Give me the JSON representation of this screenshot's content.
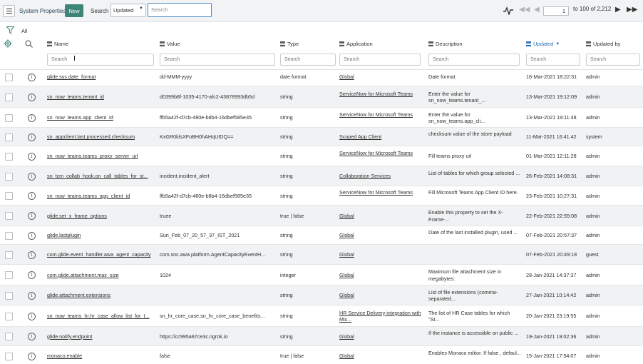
{
  "toolbar": {
    "title": "System Properties",
    "new_label": "New",
    "search_label": "Search",
    "search_field": "Updated",
    "search_placeholder": "Search",
    "page_current": "1",
    "page_range": "to 100 of 2,212"
  },
  "filter": {
    "label": "All"
  },
  "columns": [
    {
      "key": "name",
      "label": "Name"
    },
    {
      "key": "value",
      "label": "Value"
    },
    {
      "key": "type",
      "label": "Type"
    },
    {
      "key": "application",
      "label": "Application"
    },
    {
      "key": "description",
      "label": "Description"
    },
    {
      "key": "updated",
      "label": "Updated",
      "sorted": "desc"
    },
    {
      "key": "updated_by",
      "label": "Updated by"
    }
  ],
  "column_search_placeholder": "Search",
  "rows": [
    {
      "name": "glide.sys.date_format",
      "value": "dd-MMM-yyyy",
      "type": "date format",
      "application": "Global",
      "description": "Date format",
      "updated": "16-Mar-2021 18:22:31",
      "updated_by": "admin"
    },
    {
      "name": "sn_now_teams.tenant_id",
      "value": "d0399b8f-1035-4170-afc2-43878993db5d",
      "type": "string",
      "application": "ServiceNow for Microsoft Teams",
      "description": "Enter the value for sn_now_teams.tenant_...",
      "updated": "13-Mar-2021 19:12:09",
      "updated_by": "admin"
    },
    {
      "name": "sn_now_teams.app_client_id",
      "value": "ffb5a42f-d7cb-480e-b8b4-16dbef585e35",
      "type": "string",
      "application": "ServiceNow for Microsoft Teams",
      "description": "Enter the value for sn_now_teams.app_cli...",
      "updated": "13-Mar-2021 19:11:48",
      "updated_by": "admin"
    },
    {
      "name": "sn_appclient.last.processed.checksum",
      "value": "KxGR0klsXFoBH0hAHqUIDQ==",
      "type": "string",
      "application": "Scoped App Client",
      "description": "checksum value of the store payload",
      "updated": "11-Mar-2021 16:41:42",
      "updated_by": "system"
    },
    {
      "name": "sn_now_teams.teams_proxy_server_url",
      "value": "",
      "type": "string",
      "application": "ServiceNow for Microsoft Teams",
      "description": "Fill teams proxy url",
      "updated": "01-Mar-2021 12:11:28",
      "updated_by": "admin"
    },
    {
      "name": "sn_tcm_collab_hook.on_call_tables_for_st...",
      "value": "incident,incident_alert",
      "type": "string",
      "application": "Collaboration Services",
      "description": "List of tables for which group selected ...",
      "updated": "26-Feb-2021 14:08:31",
      "updated_by": "admin"
    },
    {
      "name": "sn_now_teams.teams_app_client_id",
      "value": "ffb5a42f-d7cb-480e-b8b4-16dbef585e35",
      "type": "string",
      "application": "ServiceNow for Microsoft Teams",
      "description": "Fill Microsoft Teams App Client ID here.",
      "updated": "23-Feb-2021 10:27:31",
      "updated_by": "admin"
    },
    {
      "name": "glide.set_x_frame_options",
      "value": "truee",
      "type": "true | false",
      "application": "Global",
      "description": "Enable this property to set the X-Frame-...",
      "updated": "22-Feb-2021 22:55:08",
      "updated_by": "admin"
    },
    {
      "name": "glide.lastplugin",
      "value": "Sun_Feb_07_20_57_37_IST_2021",
      "type": "string",
      "application": "Global",
      "description": "Date of the last installed plugin, used ...",
      "updated": "07-Feb-2021 20:57:37",
      "updated_by": "admin"
    },
    {
      "name": "com.glide.event_handler.awa_agent_capacity",
      "value": "com.snc.awa.platform.AgentCapacityEventH...",
      "type": "string",
      "application": "Global",
      "description": "",
      "updated": "07-Feb-2021 20:49:18",
      "updated_by": "guest"
    },
    {
      "name": "com.glide.attachment.max_size",
      "value": "1024",
      "type": "integer",
      "application": "Global",
      "description": "Maximum file attachment size in megabytes:",
      "updated": "28-Jan-2021 14:37:37",
      "updated_by": "admin"
    },
    {
      "name": "glide.attachment.extensions",
      "value": "",
      "type": "string",
      "application": "Global",
      "description": "List of file extensions (comma-separated...",
      "updated": "27-Jan-2021 10:14:42",
      "updated_by": "admin"
    },
    {
      "name": "sn_now_teams_hr.hr_case_allow_list_for_t...",
      "value": "sn_hr_core_case,sn_hr_core_case_benefits...",
      "type": "string",
      "application": "HR Service Delivery integration with Mic...",
      "description": "The list of HR Case tables for which \"St...",
      "updated": "20-Jan-2021 23:19:55",
      "updated_by": "admin"
    },
    {
      "name": "glide.notify.endpoint",
      "value": "https://cc995a97ce3c.ngrok.io",
      "type": "string",
      "application": "Global",
      "description": "If the instance is accessible on public ...",
      "updated": "19-Jan-2021 19:02:36",
      "updated_by": "admin"
    },
    {
      "name": "monaco.enable",
      "value": "false",
      "type": "true | false",
      "application": "Global",
      "description": "Enables Monaco editor. If false , defaul...",
      "updated": "15-Jan-2021 17:54:07",
      "updated_by": "admin"
    }
  ],
  "colors": {
    "new_button": "#3d8577",
    "sorted_header": "#2a6fb3",
    "search_focus": "#4a88c5"
  },
  "icons": [
    "menu-icon",
    "caret-down-icon",
    "activity-icon",
    "first-page-icon",
    "prev-page-icon",
    "next-page-icon",
    "last-page-icon",
    "filter-icon",
    "gear-icon",
    "search-icon",
    "info-icon",
    "text-cursor-icon"
  ]
}
